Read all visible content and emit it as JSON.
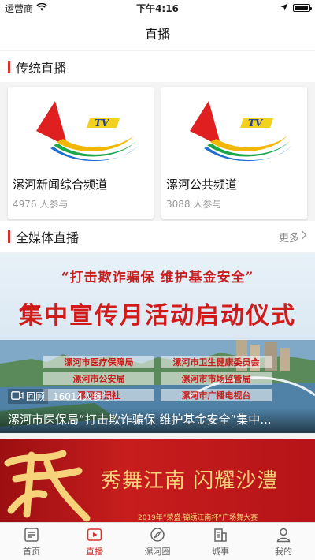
{
  "status_bar": {
    "carrier": "运营商",
    "time": "下午4:16",
    "battery_level": 0.95
  },
  "nav": {
    "title": "直播"
  },
  "traditional": {
    "title": "传统直播",
    "channels": [
      {
        "name": "漯河新闻综合频道",
        "count": "4976 人参与",
        "logo_text": "TV"
      },
      {
        "name": "漯河公共频道",
        "count": "3088 人参与",
        "logo_text": "TV"
      }
    ]
  },
  "media": {
    "title": "全媒体直播",
    "more": "更多",
    "items": [
      {
        "slogan": "“打击欺诈骗保  维护基金安全”",
        "headline": "集中宣传月活动启动仪式",
        "orgs": [
          "漯河市医疗保障局",
          "漯河市卫生健康委员会",
          "漯河市公安局",
          "漯河市市场监管局",
          "漯河日报社",
          "漯河市广播电视台"
        ],
        "replay_label": "回顾",
        "viewers": "16014人参与",
        "caption": "漯河市医保局“打击欺诈骗保  维护基金安全”集中..."
      },
      {
        "headline": "秀舞江南 闪耀沙澧",
        "sub": "2019年“荣盛·锦绣江南杯”广场舞大赛"
      }
    ]
  },
  "tabs": [
    {
      "label": "首页",
      "icon": "news-icon"
    },
    {
      "label": "直播",
      "icon": "play-icon"
    },
    {
      "label": "漯河圈",
      "icon": "compass-icon"
    },
    {
      "label": "城事",
      "icon": "building-icon"
    },
    {
      "label": "我的",
      "icon": "user-icon"
    }
  ],
  "colors": {
    "accent": "#d6322e"
  }
}
